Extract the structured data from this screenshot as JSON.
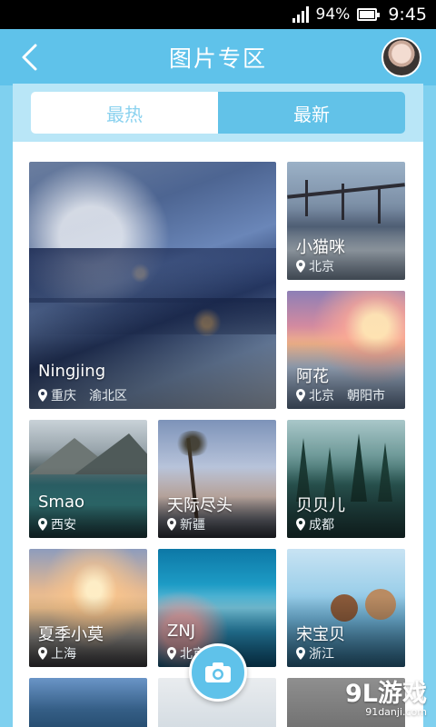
{
  "status": {
    "battery": "94%",
    "time": "9:45"
  },
  "header": {
    "title": "图片专区"
  },
  "tabs": [
    {
      "label": "最热",
      "active": true
    },
    {
      "label": "最新",
      "active": false
    }
  ],
  "cards": [
    {
      "name": "Ningjing",
      "location": "重庆　渝北区"
    },
    {
      "name": "小猫咪",
      "location": "北京"
    },
    {
      "name": "阿花",
      "location": "北京　朝阳市"
    },
    {
      "name": "Smao",
      "location": "西安"
    },
    {
      "name": "天际尽头",
      "location": "新疆"
    },
    {
      "name": "贝贝儿",
      "location": "成都"
    },
    {
      "name": "夏季小莫",
      "location": "上海"
    },
    {
      "name": "ZNJ",
      "location": "北京"
    },
    {
      "name": "宋宝贝",
      "location": "浙江"
    }
  ],
  "watermark": {
    "brand": "9L游戏",
    "domain": "91danji.com"
  },
  "colors": {
    "accent": "#5fc2ea",
    "accent_light": "#b9e6f7",
    "tab_active_text": "#8bd2ef"
  },
  "icons": {
    "back": "chevron-left-icon",
    "camera": "camera-icon",
    "location": "location-pin-icon",
    "signal": "signal-icon",
    "battery": "battery-icon"
  }
}
